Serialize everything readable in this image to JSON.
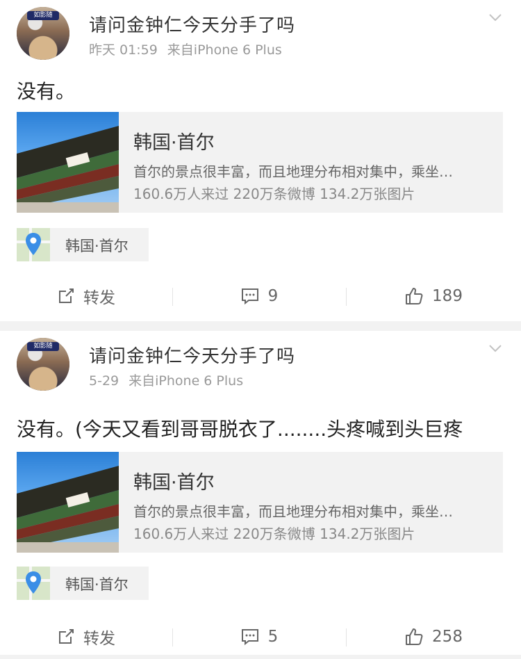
{
  "posts": [
    {
      "username": "请问金钟仁今天分手了吗",
      "time": "昨天 01:59",
      "source": "来自iPhone 6 Plus",
      "text": "没有。",
      "avatar_tag": "如影随",
      "card": {
        "title": "韩国·首尔",
        "description": "首尔的景点很丰富，而且地理分布相对集中，乘坐…",
        "stats": "160.6万人来过 220万条微博 134.2万张图片"
      },
      "location": "韩国·首尔",
      "actions": {
        "repost": "转发",
        "comments": "9",
        "likes": "189"
      }
    },
    {
      "username": "请问金钟仁今天分手了吗",
      "time": "5-29",
      "source": "来自iPhone 6 Plus",
      "text": "没有。(今天又看到哥哥脱衣了........头疼喊到头巨疼",
      "avatar_tag": "如影随",
      "card": {
        "title": "韩国·首尔",
        "description": "首尔的景点很丰富，而且地理分布相对集中，乘坐…",
        "stats": "160.6万人来过 220万条微博 134.2万张图片"
      },
      "location": "韩国·首尔",
      "actions": {
        "repost": "转发",
        "comments": "5",
        "likes": "258"
      }
    }
  ],
  "colors": {
    "background": "#f2f2f2",
    "card": "#f2f2f2",
    "meta_text": "#999999",
    "pin": "#3a8ee6"
  },
  "icons": [
    "avatar",
    "chevron-down-icon",
    "map-pin-icon",
    "repost-icon",
    "comment-icon",
    "like-icon"
  ]
}
